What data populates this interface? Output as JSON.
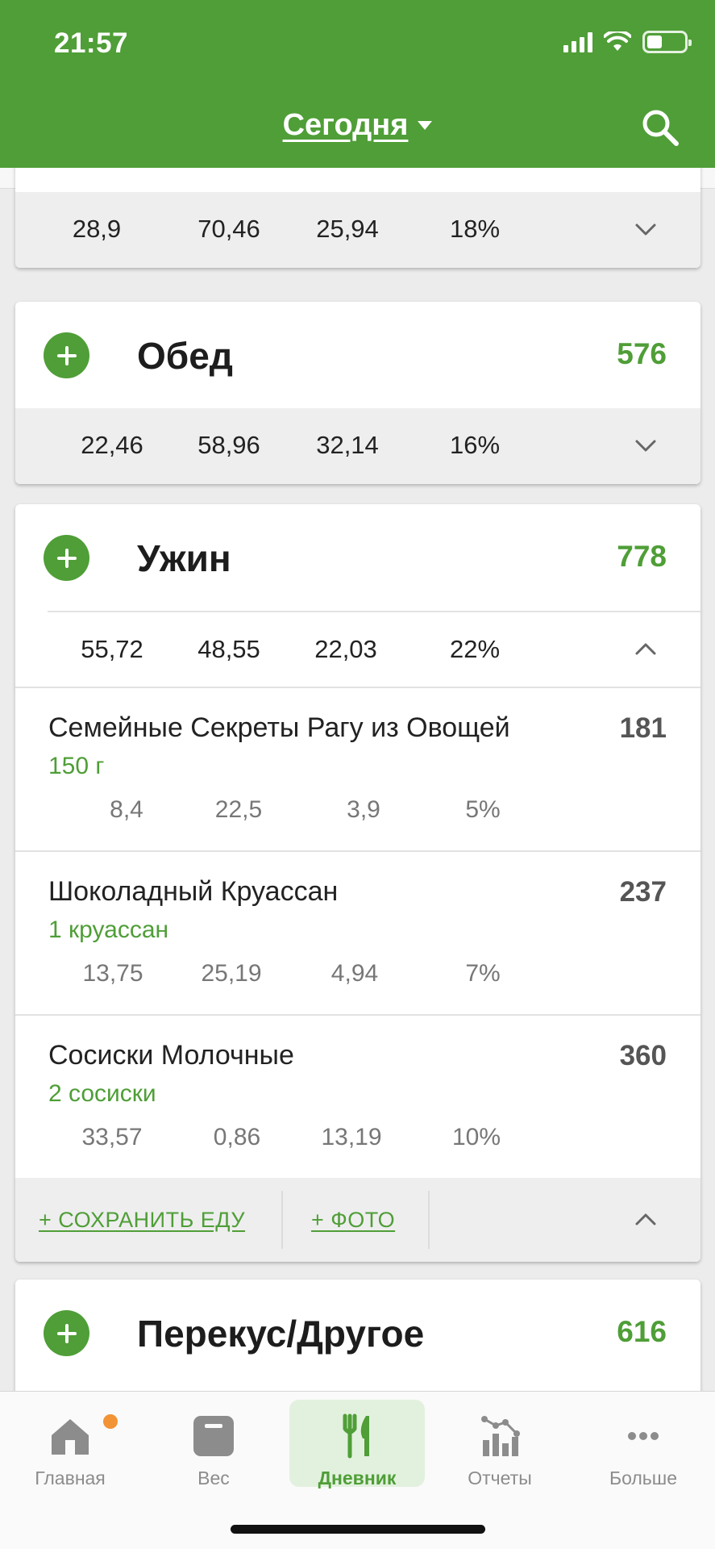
{
  "status": {
    "time": "21:57"
  },
  "header": {
    "title": "Сегодня"
  },
  "meals": {
    "partial": {
      "macros": [
        "28,9",
        "70,46",
        "25,94",
        "18%"
      ]
    },
    "lunch": {
      "name": "Обед",
      "calories": "576",
      "macros": [
        "22,46",
        "58,96",
        "32,14",
        "16%"
      ]
    },
    "dinner": {
      "name": "Ужин",
      "calories": "778",
      "macros": [
        "55,72",
        "48,55",
        "22,03",
        "22%"
      ],
      "items": [
        {
          "name": "Семейные Секреты Рагу из Овощей",
          "serving": "150 г",
          "calories": "181",
          "macros": [
            "8,4",
            "22,5",
            "3,9",
            "5%"
          ]
        },
        {
          "name": "Шоколадный Круассан",
          "serving": "1 круассан",
          "calories": "237",
          "macros": [
            "13,75",
            "25,19",
            "4,94",
            "7%"
          ]
        },
        {
          "name": "Сосиски Молочные",
          "serving": "2 сосиски",
          "calories": "360",
          "macros": [
            "33,57",
            "0,86",
            "13,19",
            "10%"
          ]
        }
      ],
      "actions": {
        "save_food": "+ СОХРАНИТЬ ЕДУ",
        "photo": "+ ФОТО"
      }
    },
    "snack": {
      "name": "Перекус/Другое",
      "calories": "616"
    }
  },
  "tabbar": {
    "tabs": [
      {
        "label": "Главная",
        "icon": "home-icon"
      },
      {
        "label": "Вес",
        "icon": "scale-icon"
      },
      {
        "label": "Дневник",
        "icon": "fork-knife-icon"
      },
      {
        "label": "Отчеты",
        "icon": "chart-icon"
      },
      {
        "label": "Больше",
        "icon": "more-icon"
      }
    ],
    "active": "Дневник"
  },
  "colors": {
    "brand": "#4f9e37",
    "notification": "#f29335"
  }
}
